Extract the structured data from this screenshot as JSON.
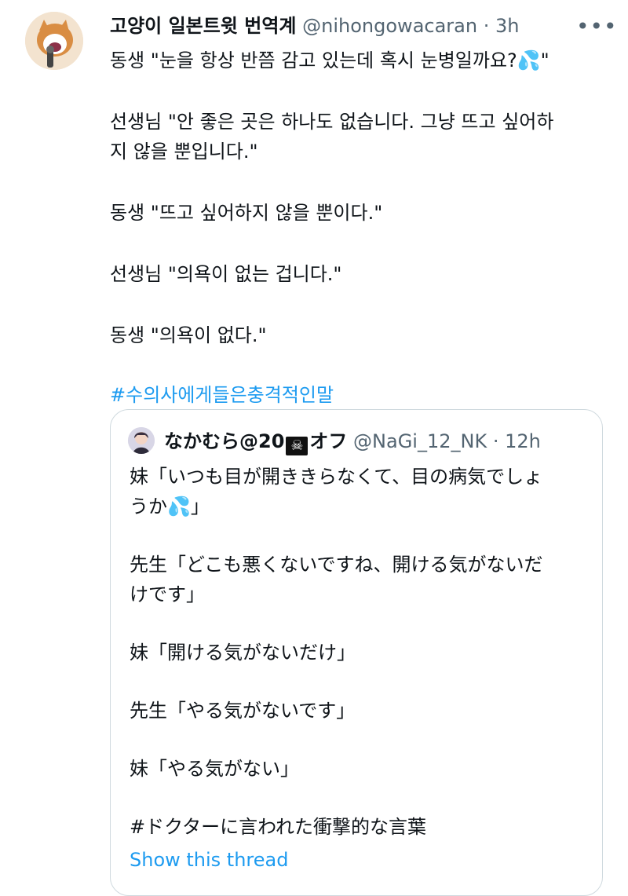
{
  "tweet": {
    "name": "고양이 일본트윗 번역계",
    "handle": "@nihongowacaran",
    "separator": "·",
    "time": "3h",
    "more_icon": "more-icon",
    "lines": [
      [
        "동생 \"눈을 항상 반쯤 감고 있는데 혹시 눈병일까요?",
        "💦",
        "\""
      ],
      [
        "선생님 \"안 좋은 곳은 하나도 없습니다. 그냥 뜨고 싶어하",
        "지 않을 뿐입니다.\""
      ],
      [
        "동생 \"뜨고 싶어하지 않을 뿐이다.\""
      ],
      [
        "선생님 \"의욕이 없는 겁니다.\""
      ],
      [
        "동생 \"의욕이 없다.\""
      ]
    ],
    "hashtag": "#수의사에게들은충격적인말"
  },
  "quote": {
    "name_prefix": "なかむら@20",
    "name_suffix": "オフ",
    "skull": "☠",
    "handle": "@NaGi_12_NK",
    "separator": "·",
    "time": "12h",
    "lines": [
      [
        "妹「いつも目が開ききらなくて、目の病気でしょ",
        "うか",
        "💦",
        "」"
      ],
      [
        "先生「どこも悪くないですね、開ける気がないだ",
        "けです」"
      ],
      [
        "妹「開ける気がないだけ」"
      ],
      [
        "先生「やる気がないです」"
      ],
      [
        "妹「やる気がない」"
      ],
      [
        "#ドクターに言われた衝撃的な言葉"
      ]
    ],
    "show_thread": "Show this thread"
  },
  "colors": {
    "link": "#1d9bf0",
    "secondary_text": "#536471",
    "border": "#cfd9de"
  }
}
